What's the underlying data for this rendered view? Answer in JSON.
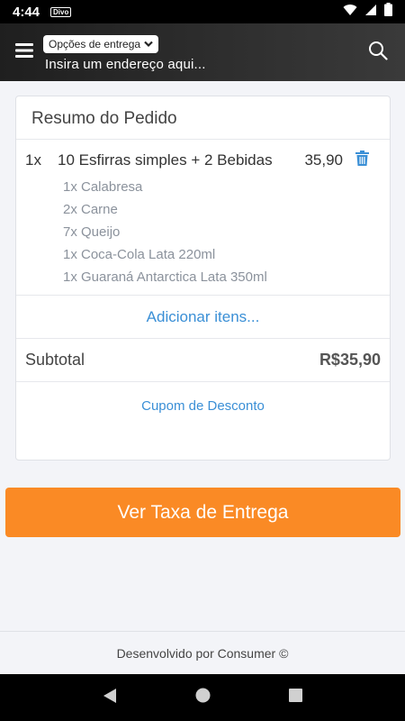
{
  "status_bar": {
    "time": "4:44",
    "notification_badge": "Divo",
    "icons": [
      "wifi-icon",
      "signal-icon",
      "battery-icon"
    ]
  },
  "app_bar": {
    "delivery_option_label": "Opções de entrega",
    "address_placeholder": "Insira um endereço aqui...",
    "menu_icon": "hamburger-menu-icon",
    "search_icon": "search-icon"
  },
  "order_summary": {
    "title": "Resumo do Pedido",
    "items": [
      {
        "qty": "1x",
        "name": "10 Esfirras simples + 2 Bebidas",
        "price": "35,90",
        "sub_items": [
          "1x Calabresa",
          "2x Carne",
          "7x Queijo",
          "1x Coca-Cola Lata 220ml",
          "1x Guaraná Antarctica Lata 350ml"
        ]
      }
    ],
    "add_items_label": "Adicionar itens...",
    "subtotal_label": "Subtotal",
    "subtotal_value": "R$35,90",
    "coupon_label": "Cupom de Desconto"
  },
  "cta": {
    "label": "Ver Taxa de Entrega"
  },
  "footer": {
    "text": "Desenvolvido por Consumer ©"
  },
  "colors": {
    "accent_orange": "#fa8a25",
    "link_blue": "#3a8fd6",
    "app_bar_dark": "#2b2b2b",
    "background": "#f3f4f8"
  }
}
